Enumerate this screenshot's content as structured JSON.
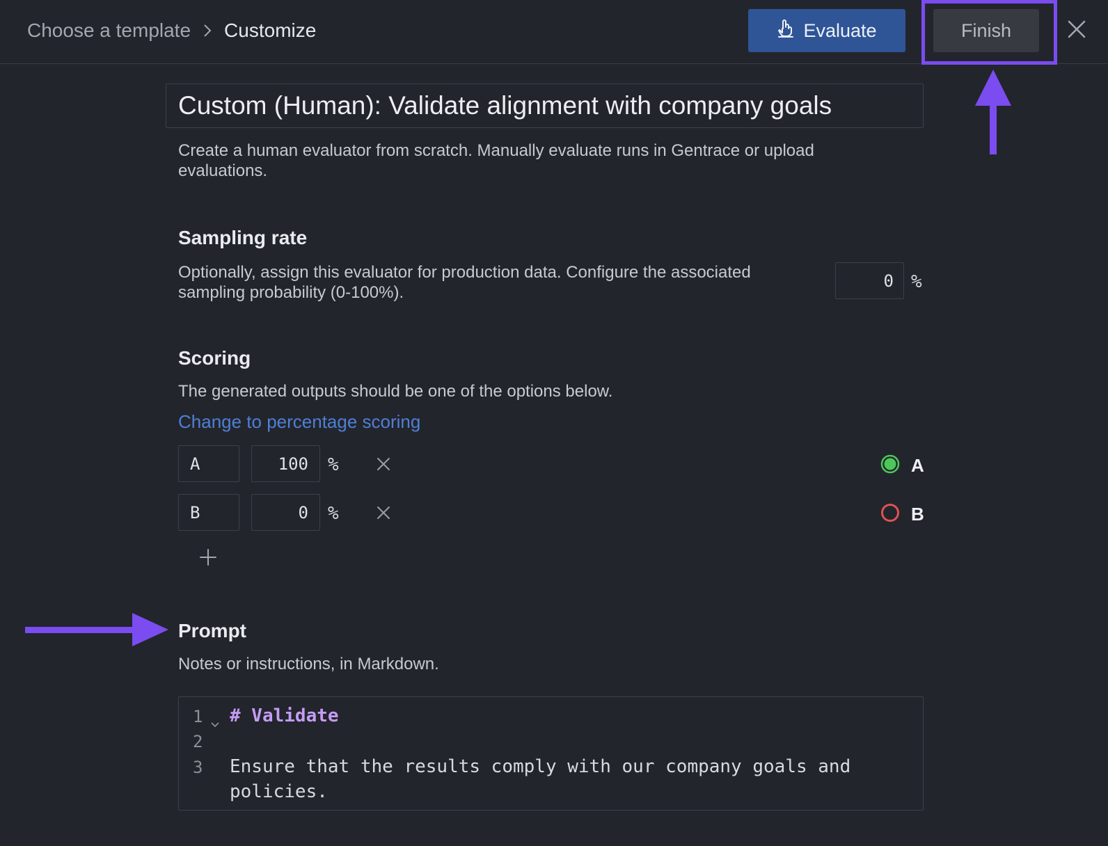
{
  "header": {
    "breadcrumb": [
      "Choose a template",
      "Customize"
    ],
    "evaluate_label": "Evaluate",
    "finish_label": "Finish"
  },
  "evaluator": {
    "title": "Custom (Human): Validate alignment with company goals",
    "description": "Create a human evaluator from scratch. Manually evaluate runs in Gentrace or upload evaluations."
  },
  "sampling": {
    "heading": "Sampling rate",
    "description": "Optionally, assign this evaluator for production data. Configure the associated sampling probability (0-100%).",
    "value": "0",
    "unit": "%"
  },
  "scoring": {
    "heading": "Scoring",
    "description": "The generated outputs should be one of the options below.",
    "link": "Change to percentage scoring",
    "unit": "%",
    "options": [
      {
        "name": "A",
        "value": "100",
        "legend": "A",
        "color": "#4cc85a"
      },
      {
        "name": "B",
        "value": "0",
        "legend": "B",
        "color": "#e05252"
      }
    ]
  },
  "prompt": {
    "heading": "Prompt",
    "description": "Notes or instructions, in Markdown.",
    "line_numbers": [
      "1",
      "2",
      "3"
    ],
    "lines": [
      "# Validate",
      "",
      "Ensure that the results comply with our company goals and",
      "policies."
    ]
  },
  "colors": {
    "background": "#22252c",
    "accent": "#7b4cf0",
    "primary_button": "#2f5597",
    "link": "#4f7fd6"
  }
}
